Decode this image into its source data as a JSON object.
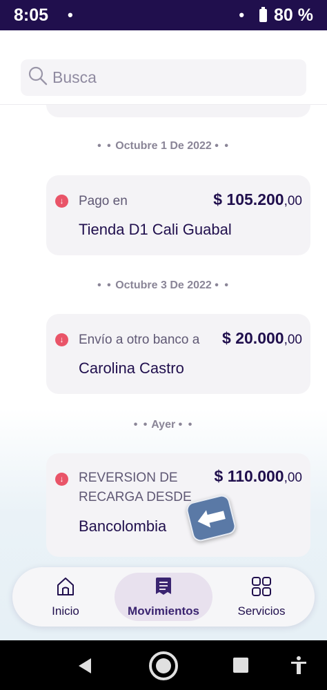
{
  "status_bar": {
    "time": "8:05",
    "left_dot": "•",
    "right_dot": "•",
    "battery": "80 %"
  },
  "search": {
    "placeholder": "Busca"
  },
  "groups": [
    {
      "date": "Octubre 1 De 2022",
      "transactions": [
        {
          "label": "Pago en",
          "amount_main": "$ 105.200",
          "amount_cents": ",00",
          "merchant": "Tienda D1 Cali Guabal"
        }
      ]
    },
    {
      "date": "Octubre 3 De 2022",
      "transactions": [
        {
          "label": "Envío a otro banco a",
          "amount_main": "$ 20.000",
          "amount_cents": ",00",
          "merchant": "Carolina Castro"
        }
      ]
    },
    {
      "date": "Ayer",
      "transactions": [
        {
          "label_line1": "REVERSION DE",
          "label_line2": "RECARGA DESDE",
          "amount_main": "$ 110.000",
          "amount_cents": ",00",
          "merchant": "Bancolombia"
        }
      ]
    }
  ],
  "separator_dots": "• •",
  "bottom_nav": {
    "items": [
      {
        "label": "Inicio",
        "icon": "home-icon",
        "active": false
      },
      {
        "label": "Movimientos",
        "icon": "document-icon",
        "active": true
      },
      {
        "label": "Servicios",
        "icon": "grid-icon",
        "active": false
      }
    ]
  },
  "colors": {
    "status_bar": "#200f4d",
    "primary_text": "#200f4d",
    "debit_icon": "#e95468",
    "card_bg": "#f4f3f6",
    "active_nav_bg": "#e8e1ee"
  }
}
